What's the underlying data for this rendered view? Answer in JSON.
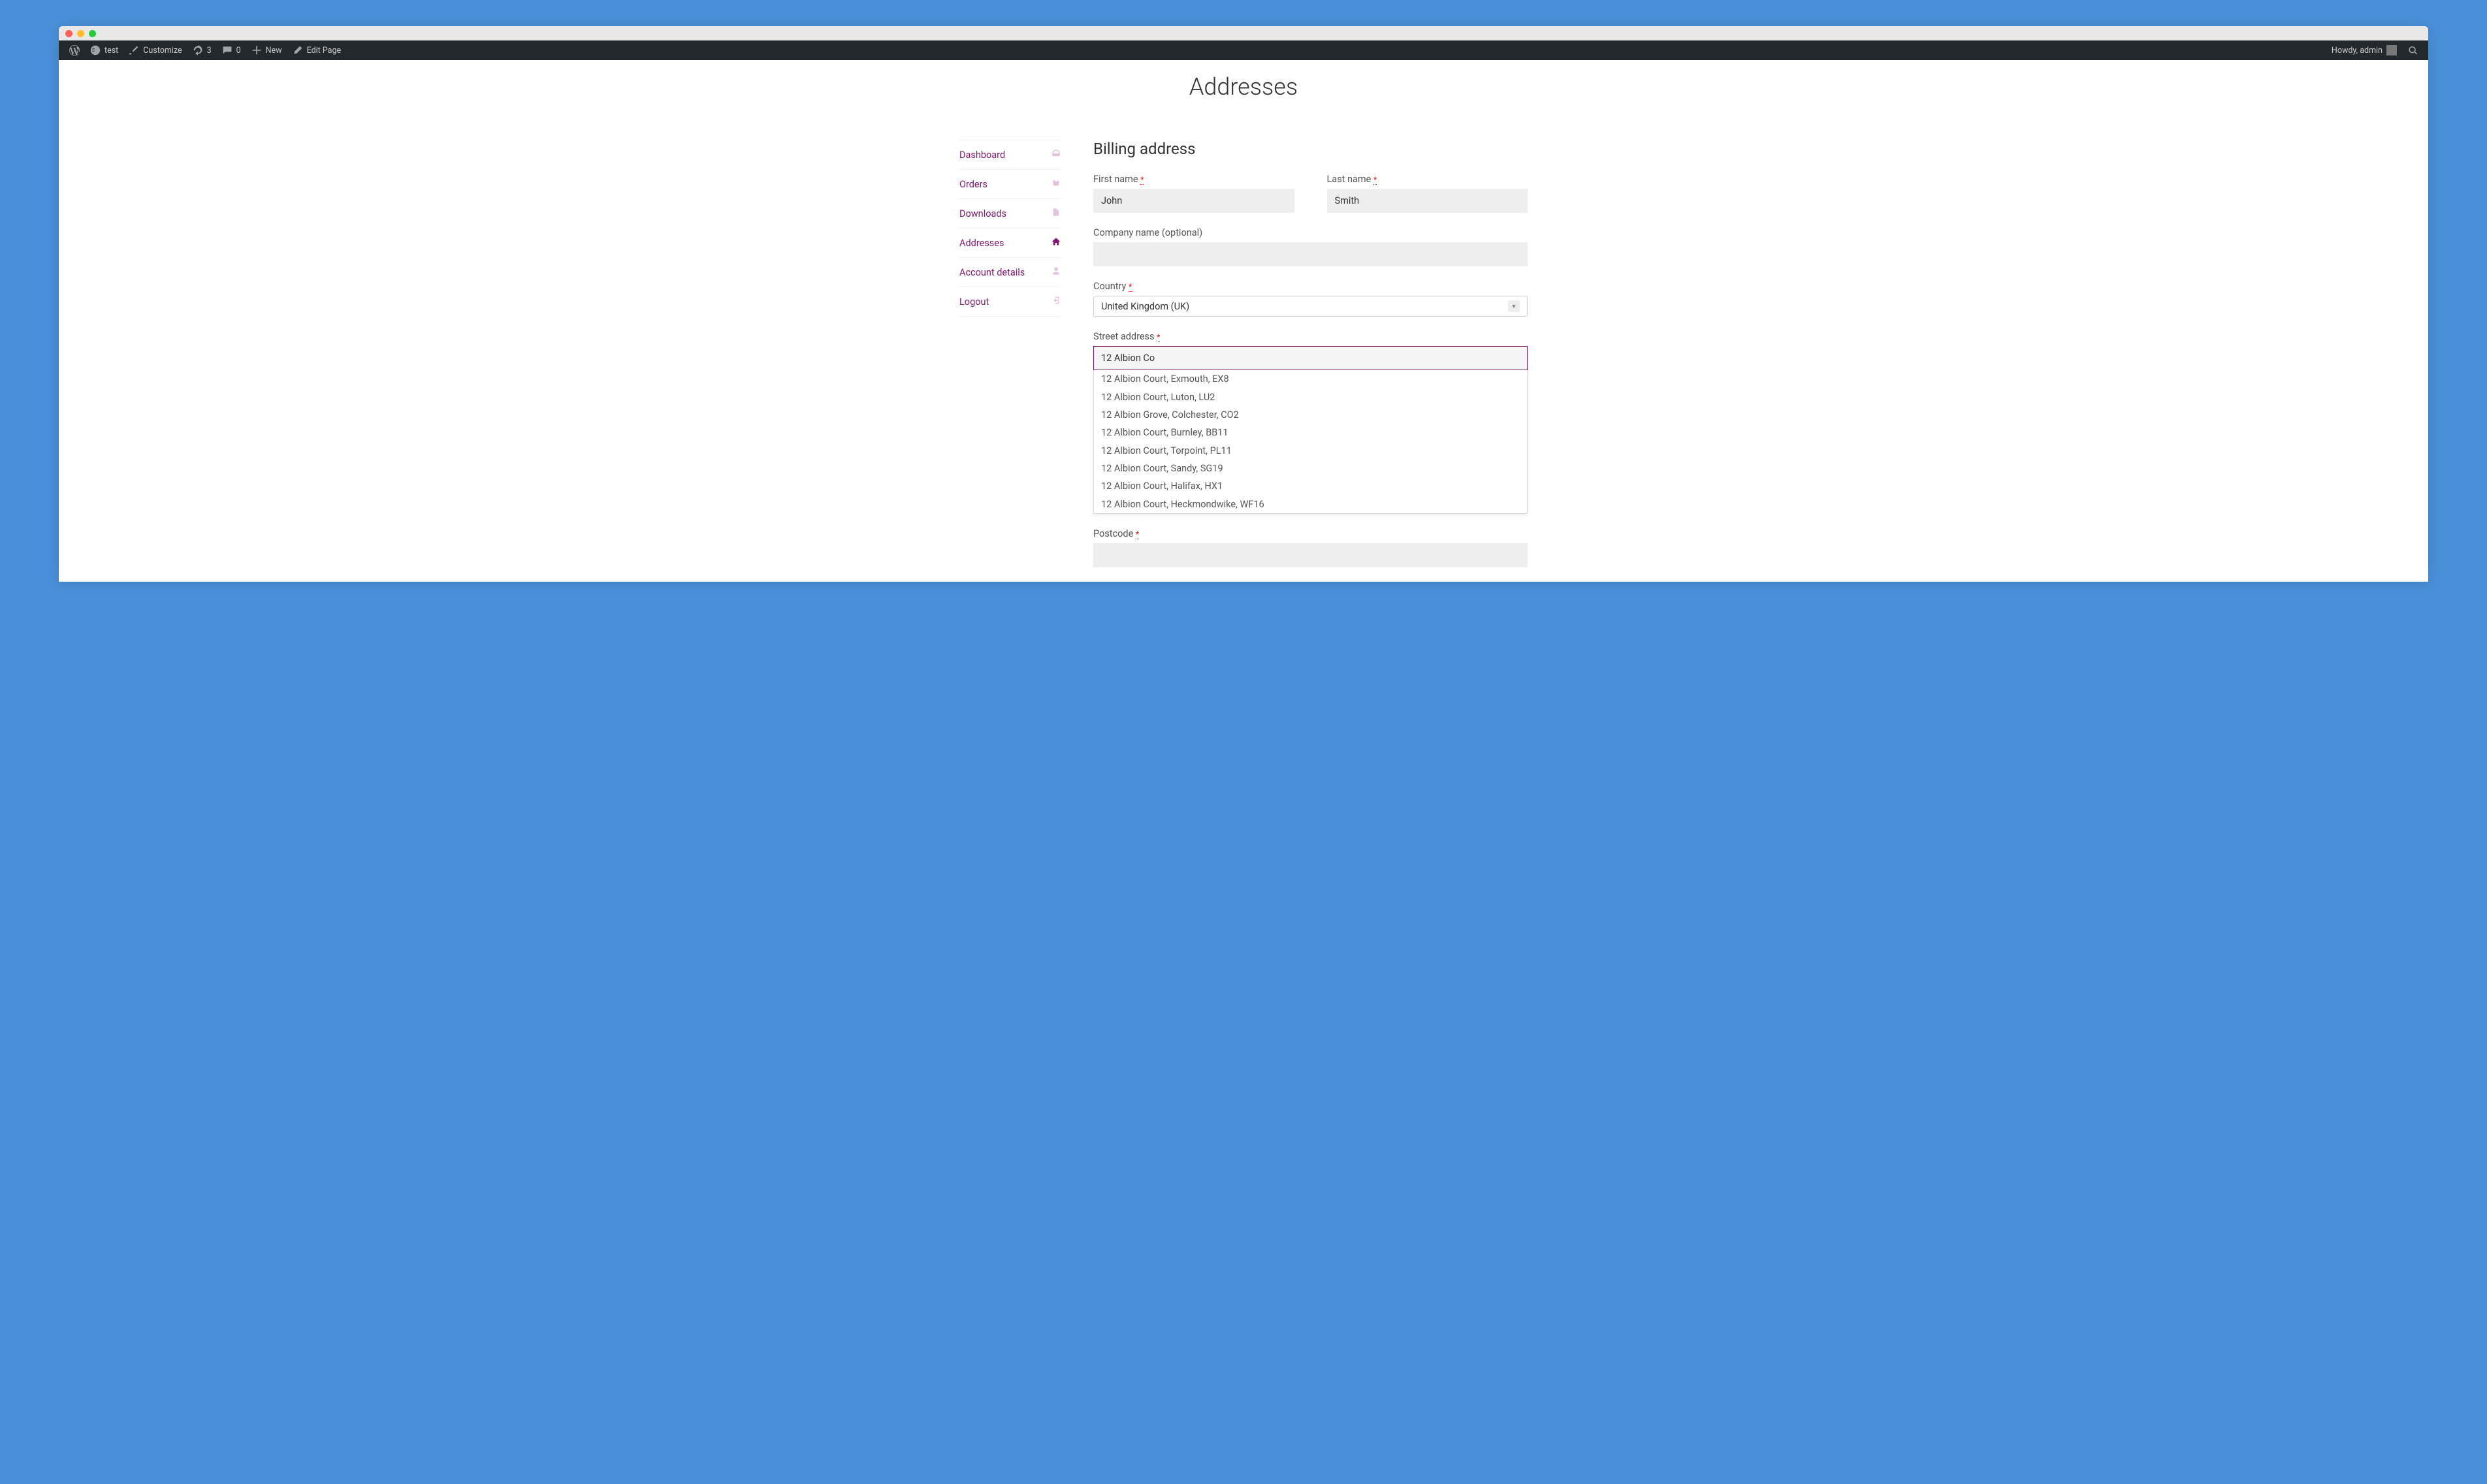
{
  "adminbar": {
    "site_name": "test",
    "customize": "Customize",
    "updates": "3",
    "comments": "0",
    "new": "New",
    "edit": "Edit Page",
    "howdy": "Howdy, admin"
  },
  "page_title": "Addresses",
  "nav": {
    "items": [
      {
        "label": "Dashboard"
      },
      {
        "label": "Orders"
      },
      {
        "label": "Downloads"
      },
      {
        "label": "Addresses"
      },
      {
        "label": "Account details"
      },
      {
        "label": "Logout"
      }
    ]
  },
  "form": {
    "title": "Billing address",
    "first_name_label": "First name",
    "first_name_value": "John",
    "last_name_label": "Last name",
    "last_name_value": "Smith",
    "company_label": "Company name (optional)",
    "company_value": "",
    "country_label": "Country",
    "country_value": "United Kingdom (UK)",
    "street_label": "Street address",
    "street_value": "12 Albion Co",
    "postcode_label": "Postcode",
    "postcode_value": ""
  },
  "autocomplete": [
    "12 Albion Court, Exmouth, EX8",
    "12 Albion Court, Luton, LU2",
    "12 Albion Grove, Colchester, CO2",
    "12 Albion Court, Burnley, BB11",
    "12 Albion Court, Torpoint, PL11",
    "12 Albion Court, Sandy, SG19",
    "12 Albion Court, Halifax, HX1",
    "12 Albion Court, Heckmondwike, WF16"
  ]
}
